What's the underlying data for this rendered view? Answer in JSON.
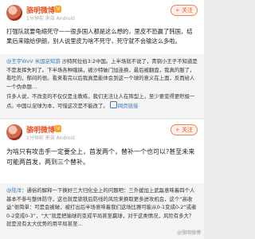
{
  "posts": [
    {
      "author": "骆明微博",
      "vip_badge": "V",
      "time": "1分钟前",
      "source": "来自 Android",
      "follow_label": "+ 关注",
      "text": "打强队就要龟缩死守一一很多国人都是这么想的，里皮不恐赢了韩国，结果后来输给伊朗，别人说里皮为啥不死守，死守就不会输这么多啦。",
      "quote": {
        "user": "@王宇WvV",
        "user_tail": "米国足知游",
        "text": "沙特阿拉伯3:2中国。上半场就不说了，青铜小王子不知道是不是发挥失利了。下半场各种瞎搞，被沙特破门加连换，最后被翻盘，我真的服了，看吐的，郁闷的很。看来看完以后我真是能体会到这一个球的意义在上面，反而给人一个伪命题…",
        "text2": "许多人说，不改变的不仅仅是主教练，我们无法让人在阵型上，至少要变得更积极一点。中国以足球为本，可惜这次是不能改了。",
        "link": "网页链接"
      }
    },
    {
      "author": "骆明微博",
      "vip_badge": "V",
      "time": "1分钟前",
      "source": "来自 Android",
      "follow_label": "+ 关注",
      "text": "为啥只有攻击手一定要全上，首发两个，替补一个也可以?甚至未来可能两首发，两到三个替补。",
      "quote": {
        "user": "@陆洋",
        "text": "：通俗的解释一下换好三大归化全上的问题吧：三外援加上武磊意味着四个人基本不参与整体防守，这也就是锁铁后防线的风险来换取更多进攻机会，这个“高收益”很简单：可是会被破，被打出后半场意味着我们这场比赛可能从0-1变成0-2“或者0-2变成0-3”，“大”就是把输球的变成平局甚至赢球，对于这类情况，风险有多大？就是没有太大优势的用平局甚至…"
      },
      "watermark": "@骆明微博"
    }
  ]
}
